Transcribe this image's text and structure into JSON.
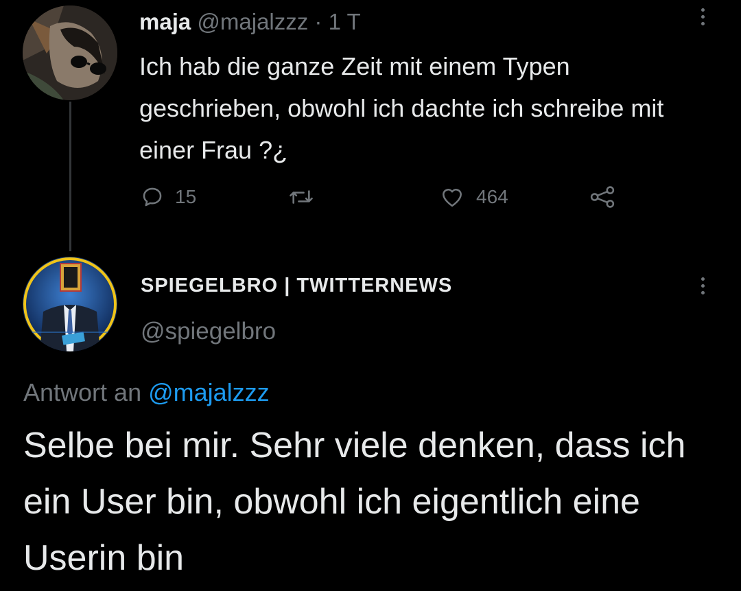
{
  "tweet1": {
    "display_name": "maja",
    "handle": "@majalzzz",
    "separator": "·",
    "timestamp": "1 T",
    "text": "Ich hab die ganze Zeit mit einem Typen geschrieben, obwohl ich dachte ich schreibe mit einer Frau ?¿",
    "avatar_icon": "profile-photo-sunglasses",
    "actions": {
      "reply_count": "15",
      "retweet_count": "",
      "like_count": "464"
    }
  },
  "tweet2": {
    "display_name": "SPIEGELBRO | TWITTERNEWS",
    "handle": "@spiegelbro",
    "avatar_icon": "profile-photo-news-anchor",
    "reply_prefix": "Antwort an",
    "reply_handle": "@majalzzz",
    "text": "Selbe bei mir. Sehr viele denken, dass ich ein User bin, obwohl ich eigentlich eine Userin bin"
  },
  "colors": {
    "background": "#000000",
    "text_primary": "#e7e9ea",
    "text_muted": "#71767b",
    "link": "#1d9bf0",
    "thread_line": "#333639"
  }
}
